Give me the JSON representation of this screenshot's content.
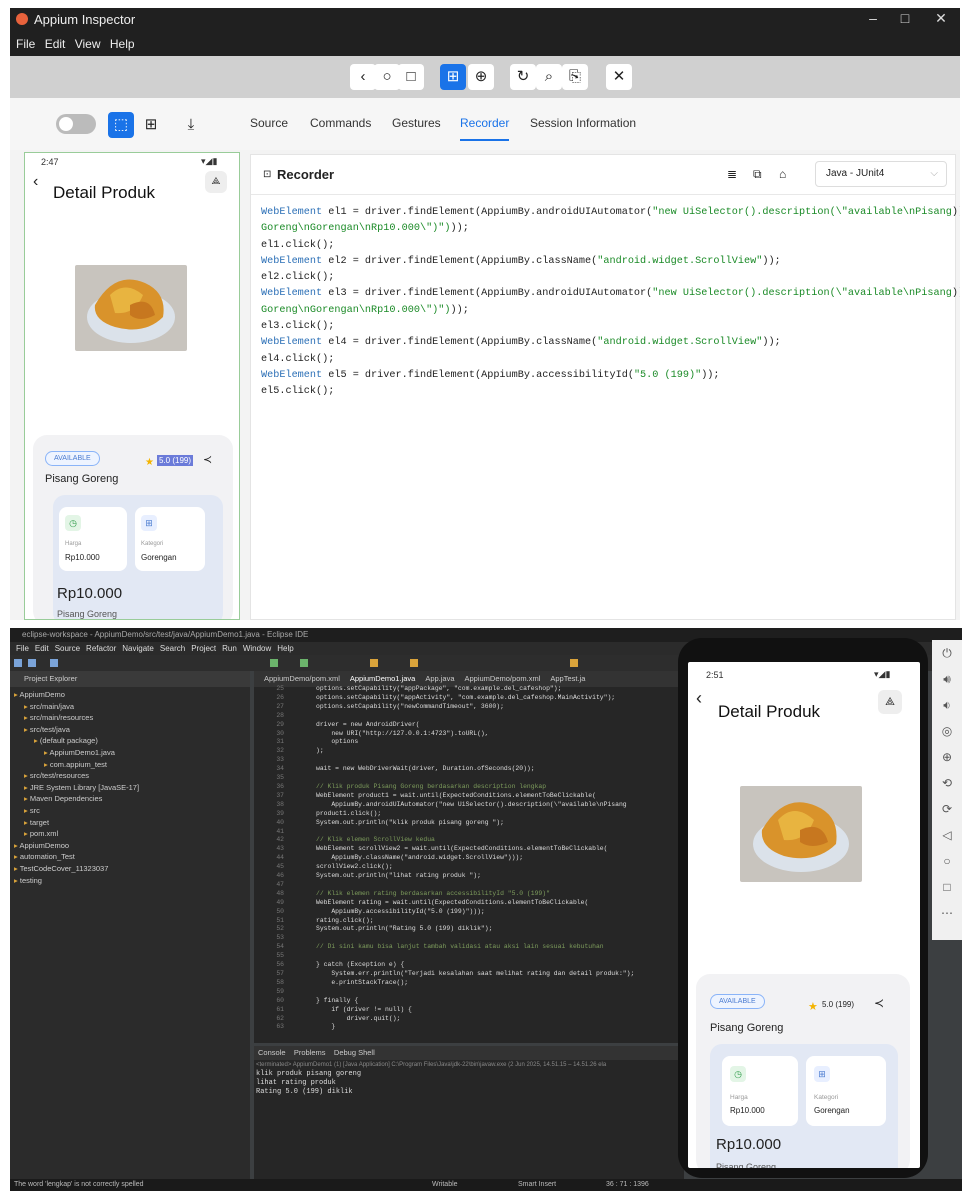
{
  "appium": {
    "title": "Appium Inspector",
    "menu": [
      "File",
      "Edit",
      "View",
      "Help"
    ],
    "nav_icons": [
      "back-icon",
      "home-icon",
      "recent-apps-icon",
      "native-app-icon",
      "web-context-icon",
      "refresh-icon",
      "search-icon",
      "screenshot-icon",
      "close-icon"
    ],
    "tabs": [
      "Source",
      "Commands",
      "Gestures",
      "Recorder",
      "Session Information"
    ],
    "active_tab": "Recorder",
    "recorder": {
      "title": "Recorder",
      "language": "Java - JUnit4",
      "code_lines": [
        [
          "WebElement",
          " el1 = driver.findElement(AppiumBy.androidUIAutomator(",
          "\"new UiSelector().description(\\\"available\\nPisang"
        ],
        [
          "",
          "",
          "Goreng\\nGorengan\\nRp10.000\\\")\")"
        ],
        [
          "",
          "el1.click();",
          ""
        ],
        [
          "WebElement",
          " el2 = driver.findElement(AppiumBy.className(",
          "\"android.widget.ScrollView\""
        ],
        [
          "",
          "el2.click();",
          ""
        ],
        [
          "WebElement",
          " el3 = driver.findElement(AppiumBy.androidUIAutomator(",
          "\"new UiSelector().description(\\\"available\\nPisang"
        ],
        [
          "",
          "",
          "Goreng\\nGorengan\\nRp10.000\\\")\")"
        ],
        [
          "",
          "el3.click();",
          ""
        ],
        [
          "WebElement",
          " el4 = driver.findElement(AppiumBy.className(",
          "\"android.widget.ScrollView\""
        ],
        [
          "",
          "el4.click();",
          ""
        ],
        [
          "WebElement",
          " el5 = driver.findElement(AppiumBy.accessibilityId(",
          "\"5.0 (199)\""
        ],
        [
          "",
          "el5.click();",
          ""
        ]
      ],
      "code_suffix": [
        "));",
        "));",
        "",
        "));",
        "",
        "));",
        "));",
        "",
        "));",
        "",
        "));",
        ""
      ]
    }
  },
  "app": {
    "time1": "2:47",
    "time2": "2:51",
    "title": "Detail Produk",
    "available": "AVAILABLE",
    "rating": "5.0 (199)",
    "product": "Pisang Goreng",
    "price_label": "Harga",
    "price": "Rp10.000",
    "category_label": "Kategori",
    "category": "Gorengan",
    "big_price": "Rp10.000",
    "bottom_name": "Pisang Goreng"
  },
  "eclipse": {
    "title": "eclipse-workspace - AppiumDemo/src/test/java/AppiumDemo1.java - Eclipse IDE",
    "menu": [
      "File",
      "Edit",
      "Source",
      "Refactor",
      "Navigate",
      "Search",
      "Project",
      "Run",
      "Window",
      "Help"
    ],
    "project_explorer": "Project Explorer",
    "tree": [
      {
        "t": "AppiumDemo",
        "d": 0
      },
      {
        "t": "src/main/java",
        "d": 1
      },
      {
        "t": "src/main/resources",
        "d": 1
      },
      {
        "t": "src/test/java",
        "d": 1
      },
      {
        "t": "(default package)",
        "d": 2
      },
      {
        "t": "AppiumDemo1.java",
        "d": 3
      },
      {
        "t": "com.appium_test",
        "d": 3
      },
      {
        "t": "src/test/resources",
        "d": 1
      },
      {
        "t": "JRE System Library [JavaSE-17]",
        "d": 1
      },
      {
        "t": "Maven Dependencies",
        "d": 1
      },
      {
        "t": "src",
        "d": 1
      },
      {
        "t": "target",
        "d": 1
      },
      {
        "t": "pom.xml",
        "d": 1
      },
      {
        "t": "AppiumDemoo",
        "d": 0
      },
      {
        "t": "automation_Test",
        "d": 0
      },
      {
        "t": "TestCodeCover_11323037",
        "d": 0
      },
      {
        "t": "testing",
        "d": 0
      }
    ],
    "editor_tabs": [
      "AppiumDemo/pom.xml",
      "AppiumDemo1.java",
      "App.java",
      "AppiumDemo/pom.xml",
      "AppTest.ja"
    ],
    "line_numbers": [
      "25",
      "26",
      "27",
      "28",
      "29",
      "30",
      "31",
      "32",
      "33",
      "34",
      "35",
      "36",
      "37",
      "38",
      "39",
      "40",
      "41",
      "42",
      "43",
      "44",
      "45",
      "46",
      "47",
      "48",
      "49",
      "50",
      "51",
      "52",
      "53",
      "54",
      "55",
      "56",
      "57",
      "58",
      "59",
      "60",
      "61",
      "62",
      "63"
    ],
    "code": [
      "options.setCapability(\"appPackage\", \"com.example.del_cafeshop\");",
      "options.setCapability(\"appActivity\", \"com.example.del_cafeshop.MainActivity\");",
      "options.setCapability(\"newCommandTimeout\", 3600);",
      "",
      "driver = new AndroidDriver(",
      "    new URI(\"http://127.0.0.1:4723\").toURL(),",
      "    options",
      ");",
      "",
      "wait = new WebDriverWait(driver, Duration.ofSeconds(20));",
      "",
      "// Klik produk Pisang Goreng berdasarkan description lengkap",
      "WebElement product1 = wait.until(ExpectedConditions.elementToBeClickable(",
      "    AppiumBy.androidUIAutomator(\"new UiSelector().description(\\\"available\\nPisang",
      "product1.click();",
      "System.out.println(\"klik produk pisang goreng \");",
      "",
      "// Klik elemen ScrollView kedua",
      "WebElement scrollView2 = wait.until(ExpectedConditions.elementToBeClickable(",
      "    AppiumBy.className(\"android.widget.ScrollView\")));",
      "scrollView2.click();",
      "System.out.println(\"lihat rating produk \");",
      "",
      "// Klik elemen rating berdasarkan accessibilityId \"5.0 (199)\"",
      "WebElement rating = wait.until(ExpectedConditions.elementToBeClickable(",
      "    AppiumBy.accessibilityId(\"5.0 (199)\")));",
      "rating.click();",
      "System.out.println(\"Rating 5.0 (199) diklik\");",
      "",
      "// Di sini kamu bisa lanjut tambah validasi atau aksi lain sesuai kebutuhan",
      "",
      "} catch (Exception e) {",
      "    System.err.println(\"Terjadi kesalahan saat melihat rating dan detail produk:\");",
      "    e.printStackTrace();",
      "",
      "} finally {",
      "    if (driver != null) {",
      "        driver.quit();",
      "    }"
    ],
    "console_tabs": [
      "Console",
      "Problems",
      "Debug Shell"
    ],
    "terminated": "<terminated> AppiumDemo1 (1) [Java Application] C:\\Program Files\\Java\\jdk-22\\bin\\javaw.exe (2 Jun 2025, 14.51.15 – 14.51.26 ela",
    "console_out": [
      "klik produk pisang goreng",
      "lihat rating produk",
      "Rating 5.0 (199) diklik"
    ],
    "status_msg": "The word 'lengkap' is not correctly spelled",
    "status_writable": "Writable",
    "status_insert": "Smart Insert",
    "status_pos": "36 : 71 : 1396"
  },
  "colors": {
    "accent": "#1a73e8",
    "eclipse_bg": "#2b2b2b"
  }
}
